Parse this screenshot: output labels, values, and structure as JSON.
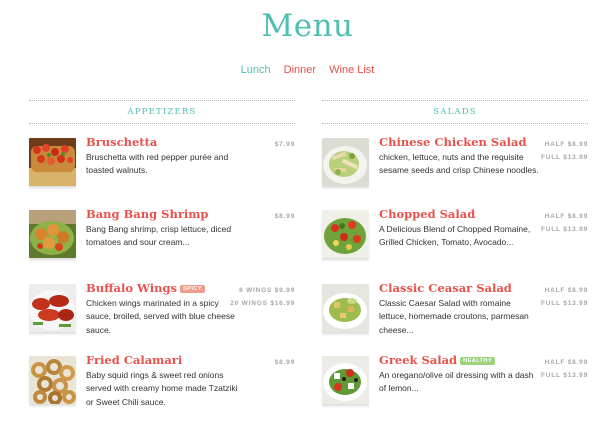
{
  "page_title": "Menu",
  "nav": [
    {
      "label": "Lunch",
      "color": "#4fbfb1"
    },
    {
      "label": "Dinner",
      "color": "#e9514a"
    },
    {
      "label": "Wine List",
      "color": "#e9514a"
    }
  ],
  "colors": {
    "accent": "#4fbfb1",
    "item_name": "#e9514a",
    "price": "#a7a7a7",
    "spicy_badge": "#ef9a8a",
    "healthy_badge": "#9bd27a"
  },
  "appetizers": {
    "heading": "Appetizers",
    "items": [
      {
        "name": "Bruschetta",
        "badge": "",
        "prices": [
          "$7.99"
        ],
        "desc_lines": [
          "Bruschetta with red pepper purée and",
          "toasted walnuts."
        ],
        "photo": "bruschetta-photo"
      },
      {
        "name": "Bang Bang Shrimp",
        "badge": "",
        "prices": [
          "$8.99"
        ],
        "desc_lines": [
          "Bang Bang shrimp, crisp lettuce, diced",
          "tomatoes and sour cream..."
        ],
        "photo": "shrimp-photo"
      },
      {
        "name": "Buffalo Wings",
        "badge": "Spicy",
        "prices": [
          "8 Wings $9.99",
          "20 Wings $16.99"
        ],
        "desc_lines": [
          "Chicken wings marinated in a spicy",
          "sauce, broiled, served with blue cheese",
          "sauce."
        ],
        "photo": "wings-photo"
      },
      {
        "name": "Fried Calamari",
        "badge": "",
        "prices": [
          "$8.99"
        ],
        "desc_lines": [
          "Baby squid rings & sweet red onions",
          "served with creamy home made Tzatziki",
          "or Sweet Chili sauce."
        ],
        "photo": "calamari-photo"
      }
    ]
  },
  "salads": {
    "heading": "Salads",
    "items": [
      {
        "name": "Chinese Chicken Salad",
        "badge": "",
        "prices": [
          "Half $8.99",
          "Full $13.99"
        ],
        "desc_lines": [
          "chicken, lettuce, nuts and the requisite",
          "sesame seeds and crisp Chinese noodles."
        ],
        "photo": "chinese-salad-photo"
      },
      {
        "name": "Chopped Salad",
        "badge": "",
        "prices": [
          "Half $8.99",
          "Full $13.99"
        ],
        "desc_lines": [
          "A Delicious Blend of Chopped Romaine,",
          "Grilled Chicken, Tomato, Avocado..."
        ],
        "photo": "chopped-salad-photo"
      },
      {
        "name": "Classic Ceasar Salad",
        "badge": "",
        "prices": [
          "Half $8.99",
          "Full $13.99"
        ],
        "desc_lines": [
          "Classic Caesar Salad with romaine",
          "lettuce, homemade croutons, parmesan",
          "cheese..."
        ],
        "photo": "caesar-salad-photo"
      },
      {
        "name": "Greek Salad",
        "badge": "Healthy",
        "prices": [
          "Half $8.99",
          "Full $13.99"
        ],
        "desc_lines": [
          "An oregano/olive oil dressing with a dash",
          "of lemon..."
        ],
        "photo": "greek-salad-photo"
      }
    ]
  }
}
